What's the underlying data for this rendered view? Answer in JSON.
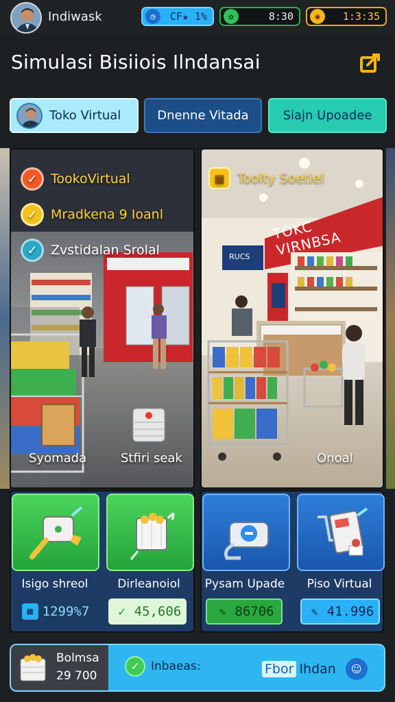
{
  "header": {
    "username": "Indiwask",
    "stats": [
      {
        "icon": "clock-icon",
        "value": "CF★ 1%"
      },
      {
        "icon": "leaf-icon",
        "value": "8:30"
      },
      {
        "icon": "gift-icon",
        "value": "1:3:35"
      }
    ]
  },
  "page": {
    "title": "Simulasi Bisiiois Ilndansai",
    "edit_icon": "edit-icon"
  },
  "tabs": [
    {
      "label": "Toko Virtual"
    },
    {
      "label": "Dnenne Vitada"
    },
    {
      "label": "Siajn Upoadee"
    }
  ],
  "scene_left": {
    "checklist": [
      {
        "label": "TookoVirtual",
        "color": "#f15a22"
      },
      {
        "label": "Mradkena 9 Ioanl",
        "color": "#f4c21a"
      },
      {
        "label": "Zvstidalan Srolal",
        "color": "#2aa9c6"
      }
    ],
    "caption_left": "Syomada",
    "caption_right": "Stfiri seak"
  },
  "scene_right": {
    "badge_label": "Toolty Soetiel",
    "store_sign": "TOKC VIRNBSA",
    "shelf_sign": "RUCS",
    "caption": "Onoal"
  },
  "tiles": [
    {
      "label": "Isigo shreol",
      "value": "1299%7",
      "icon": "cheese-tool-icon"
    },
    {
      "label": "Dirleanoiol",
      "value": "45,606",
      "icon": "basket-icon"
    },
    {
      "label": "Pysam Upade",
      "value": "86706",
      "icon": "padlock-icon"
    },
    {
      "label": "Piso Virtual",
      "value": "41.996",
      "icon": "shopping-cart-icon"
    }
  ],
  "bottom": {
    "balance_label": "Bolmsa",
    "balance_value": "29 700",
    "status_text": "Inbaeas:",
    "tag_text": "Fbor",
    "action_text": "Ihdan",
    "colors": {
      "bar": "#2fb6f0",
      "dark": "#3b3f45"
    }
  }
}
